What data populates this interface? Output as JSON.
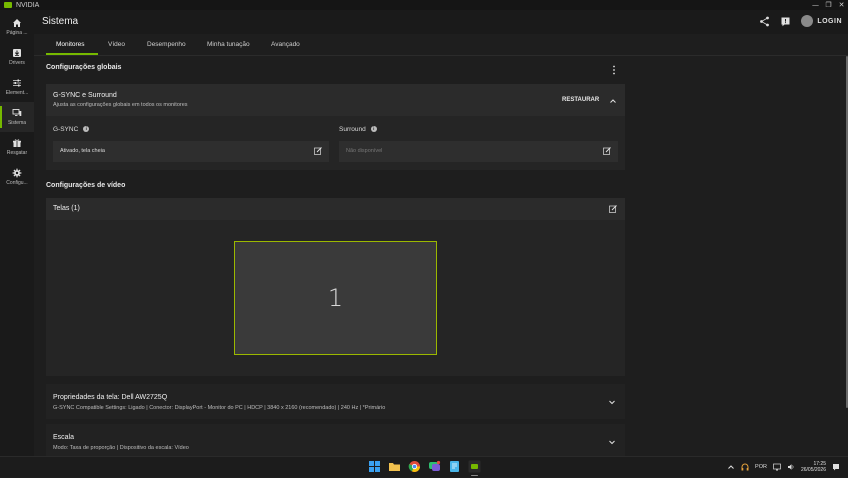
{
  "window": {
    "title": "NVIDIA",
    "controls": [
      "—",
      "❐",
      "✕"
    ]
  },
  "sidebar": {
    "items": [
      {
        "label": "Página ...",
        "icon": "home-icon"
      },
      {
        "label": "Drivers",
        "icon": "download-icon"
      },
      {
        "label": "Element...",
        "icon": "sliders-icon"
      },
      {
        "label": "Sistema",
        "icon": "monitor-icon",
        "active": true
      },
      {
        "label": "Resgatar",
        "icon": "gift-icon"
      },
      {
        "label": "Configu...",
        "icon": "gear-icon"
      }
    ]
  },
  "header": {
    "title": "Sistema",
    "login": "LOGIN"
  },
  "tabs": [
    {
      "label": "Monitores",
      "active": true
    },
    {
      "label": "Vídeo"
    },
    {
      "label": "Desempenho"
    },
    {
      "label": "Minha tunação"
    },
    {
      "label": "Avançado"
    }
  ],
  "global": {
    "title": "Configurações globais",
    "gsync_card": {
      "title": "G-SYNC e Surround",
      "subtitle": "Ajusta as configurações globais em todos os monitores",
      "restore": "RESTAURAR",
      "gsync_label": "G-SYNC",
      "gsync_value": "Ativado, tela cheia",
      "surround_label": "Surround",
      "surround_value": "Não disponível"
    }
  },
  "video": {
    "title": "Configurações de vídeo",
    "screens_title": "Telas (1)",
    "monitor_number": "1"
  },
  "display_props": {
    "title": "Propriedades da tela: Dell AW2725Q",
    "details": "G-SYNC Compatible Settings: Ligado | Conector: DisplayPort - Monitor do PC | HDCP | 3840 x 2160 (recomendado) | 240 Hz | *Primário"
  },
  "scale": {
    "title": "Escala",
    "details": "Modo: Taxa de proporção | Dispositivo da escala: Vídeo"
  },
  "taskbar": {
    "lang": "POR",
    "time": "17:25",
    "date": "26/05/2026"
  },
  "colors": {
    "accent": "#76b900",
    "background": "#1e1e1e",
    "card": "#252525"
  }
}
